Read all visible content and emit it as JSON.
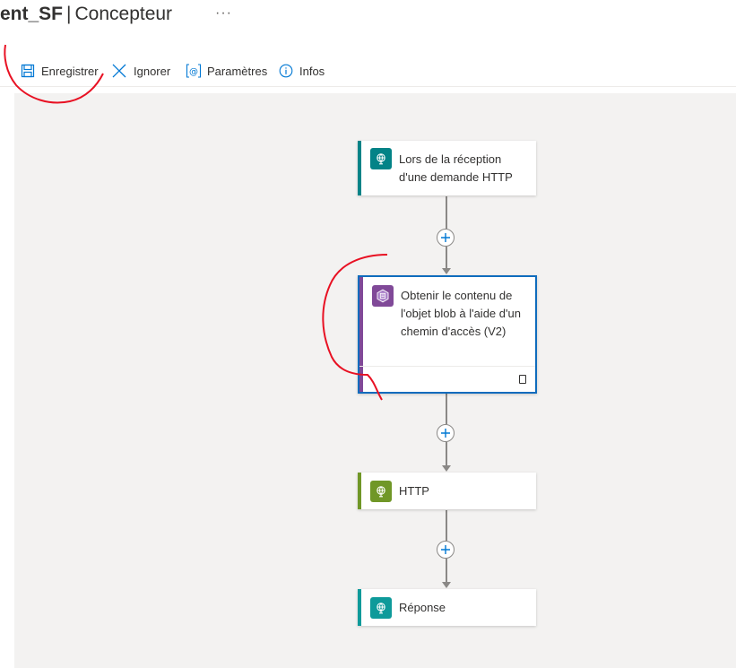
{
  "header": {
    "title_strong": "ent_SF",
    "title_separator": "|",
    "title_rest": "Concepteur",
    "more_label": "···"
  },
  "toolbar": {
    "save_label": "Enregistrer",
    "discard_label": "Ignorer",
    "parameters_label": "Paramètres",
    "info_label": "Infos"
  },
  "flow": {
    "steps": [
      {
        "title": "Lors de la réception d'une demande HTTP",
        "icon": "globe-icon",
        "accent": "#038387"
      },
      {
        "title": "Obtenir le contenu de l'objet blob à l'aide d'un chemin d'accès (V2)",
        "icon": "blob-storage-icon",
        "accent": "#804998",
        "selected": true
      },
      {
        "title": "HTTP",
        "icon": "globe-icon",
        "accent": "#709727"
      },
      {
        "title": "Réponse",
        "icon": "globe-icon",
        "accent": "#0e9a9a"
      }
    ]
  },
  "colors": {
    "primary": "#0078d4",
    "canvas_background": "#f3f2f1",
    "connector": "#8a8886",
    "annotation": "#e81123"
  }
}
